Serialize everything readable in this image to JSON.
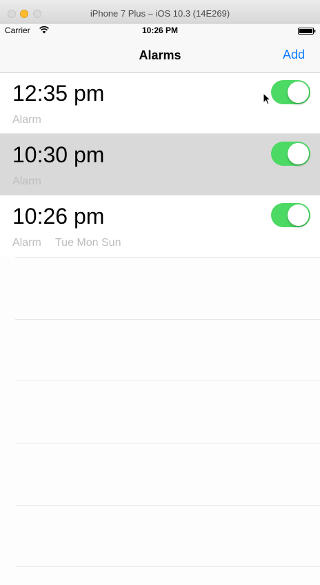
{
  "window": {
    "title": "iPhone 7 Plus – iOS 10.3 (14E269)"
  },
  "status_bar": {
    "carrier": "Carrier",
    "time": "10:26 PM",
    "wifi_icon": "wifi-icon",
    "battery_icon": "battery-icon"
  },
  "nav": {
    "title": "Alarms",
    "add_label": "Add",
    "accent_color": "#0a7aff"
  },
  "alarms": [
    {
      "time": "12:35 pm",
      "label": "Alarm",
      "days": "",
      "enabled": true,
      "selected": false
    },
    {
      "time": "10:30 pm",
      "label": "Alarm",
      "days": "",
      "enabled": true,
      "selected": true
    },
    {
      "time": "10:26 pm",
      "label": "Alarm",
      "days": "Tue Mon Sun",
      "enabled": true,
      "selected": false
    }
  ],
  "colors": {
    "toggle_on": "#4cd964",
    "selected_row": "#d9d9d9",
    "secondary_text": "#bdbdbd"
  }
}
